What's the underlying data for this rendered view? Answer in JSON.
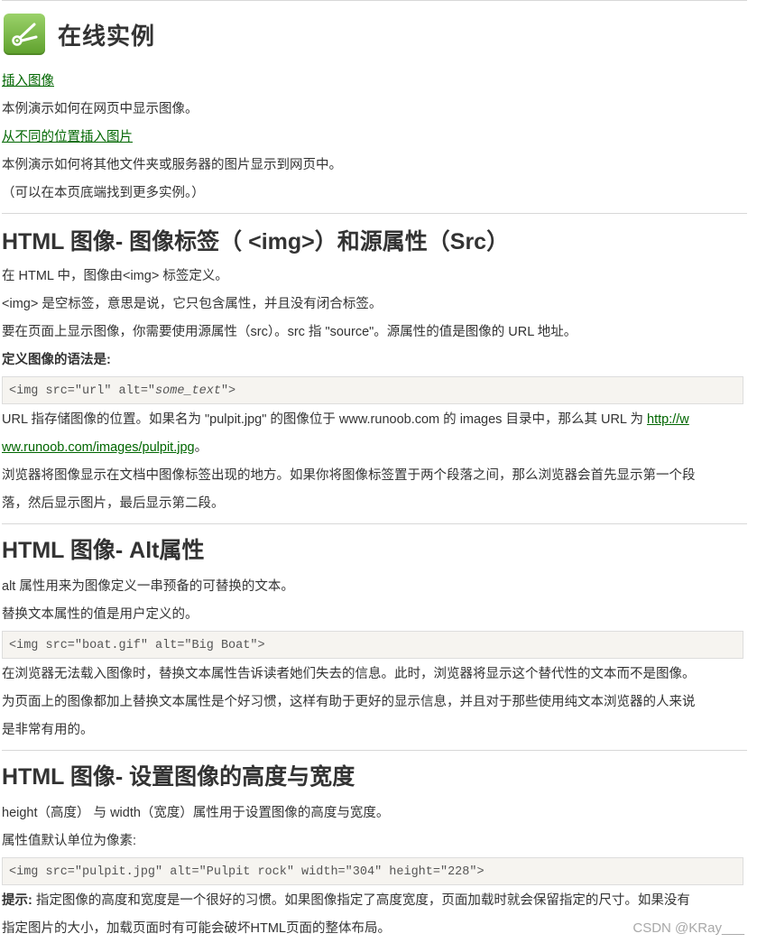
{
  "examples": {
    "title": "在线实例",
    "link1": "插入图像",
    "desc1": "本例演示如何在网页中显示图像。",
    "link2": "从不同的位置插入图片",
    "desc2": "本例演示如何将其他文件夹或服务器的图片显示到网页中。",
    "more": "（可以在本页底端找到更多实例。）"
  },
  "section1": {
    "heading": "HTML 图像- 图像标签（ <img>）和源属性（Src）",
    "p1": "在 HTML 中，图像由<img> 标签定义。",
    "p2": "<img> 是空标签，意思是说，它只包含属性，并且没有闭合标签。",
    "p3": "要在页面上显示图像，你需要使用源属性（src）。src 指 \"source\"。源属性的值是图像的 URL 地址。",
    "syntax_label": "定义图像的语法是:",
    "code_prefix": "<img src=\"url\" alt=\"",
    "code_italic": "some_text",
    "code_suffix": "\">",
    "p4_text": "URL 指存储图像的位置。如果名为 \"pulpit.jpg\" 的图像位于 www.runoob.com 的 images 目录中，那么其 URL 为 ",
    "p4_link_line1": "http://w",
    "p4_link_line2": "ww.runoob.com/images/pulpit.jpg",
    "p4_end": "。",
    "p5_line1": "浏览器将图像显示在文档中图像标签出现的地方。如果你将图像标签置于两个段落之间，那么浏览器会首先显示第一个段",
    "p5_line2": "落，然后显示图片，最后显示第二段。"
  },
  "section2": {
    "heading": "HTML 图像- Alt属性",
    "p1": "alt 属性用来为图像定义一串预备的可替换的文本。",
    "p2": "替换文本属性的值是用户定义的。",
    "code": "<img src=\"boat.gif\" alt=\"Big Boat\">",
    "p3_line1": "在浏览器无法载入图像时，替换文本属性告诉读者她们失去的信息。此时，浏览器将显示这个替代性的文本而不是图像。",
    "p3_line2": "为页面上的图像都加上替换文本属性是个好习惯，这样有助于更好的显示信息，并且对于那些使用纯文本浏览器的人来说",
    "p3_line3": "是非常有用的。"
  },
  "section3": {
    "heading": "HTML 图像- 设置图像的高度与宽度",
    "p1": "height（高度） 与 width（宽度）属性用于设置图像的高度与宽度。",
    "p2": "属性值默认单位为像素:",
    "code": "<img src=\"pulpit.jpg\" alt=\"Pulpit rock\" width=\"304\" height=\"228\">",
    "tip_label": "提示:",
    "tip_line1": " 指定图像的高度和宽度是一个很好的习惯。如果图像指定了高度宽度，页面加载时就会保留指定的尺寸。如果没有",
    "tip_line2": "指定图片的大小，加载页面时有可能会破坏HTML页面的整体布局。"
  },
  "watermark": "CSDN @KRay___"
}
